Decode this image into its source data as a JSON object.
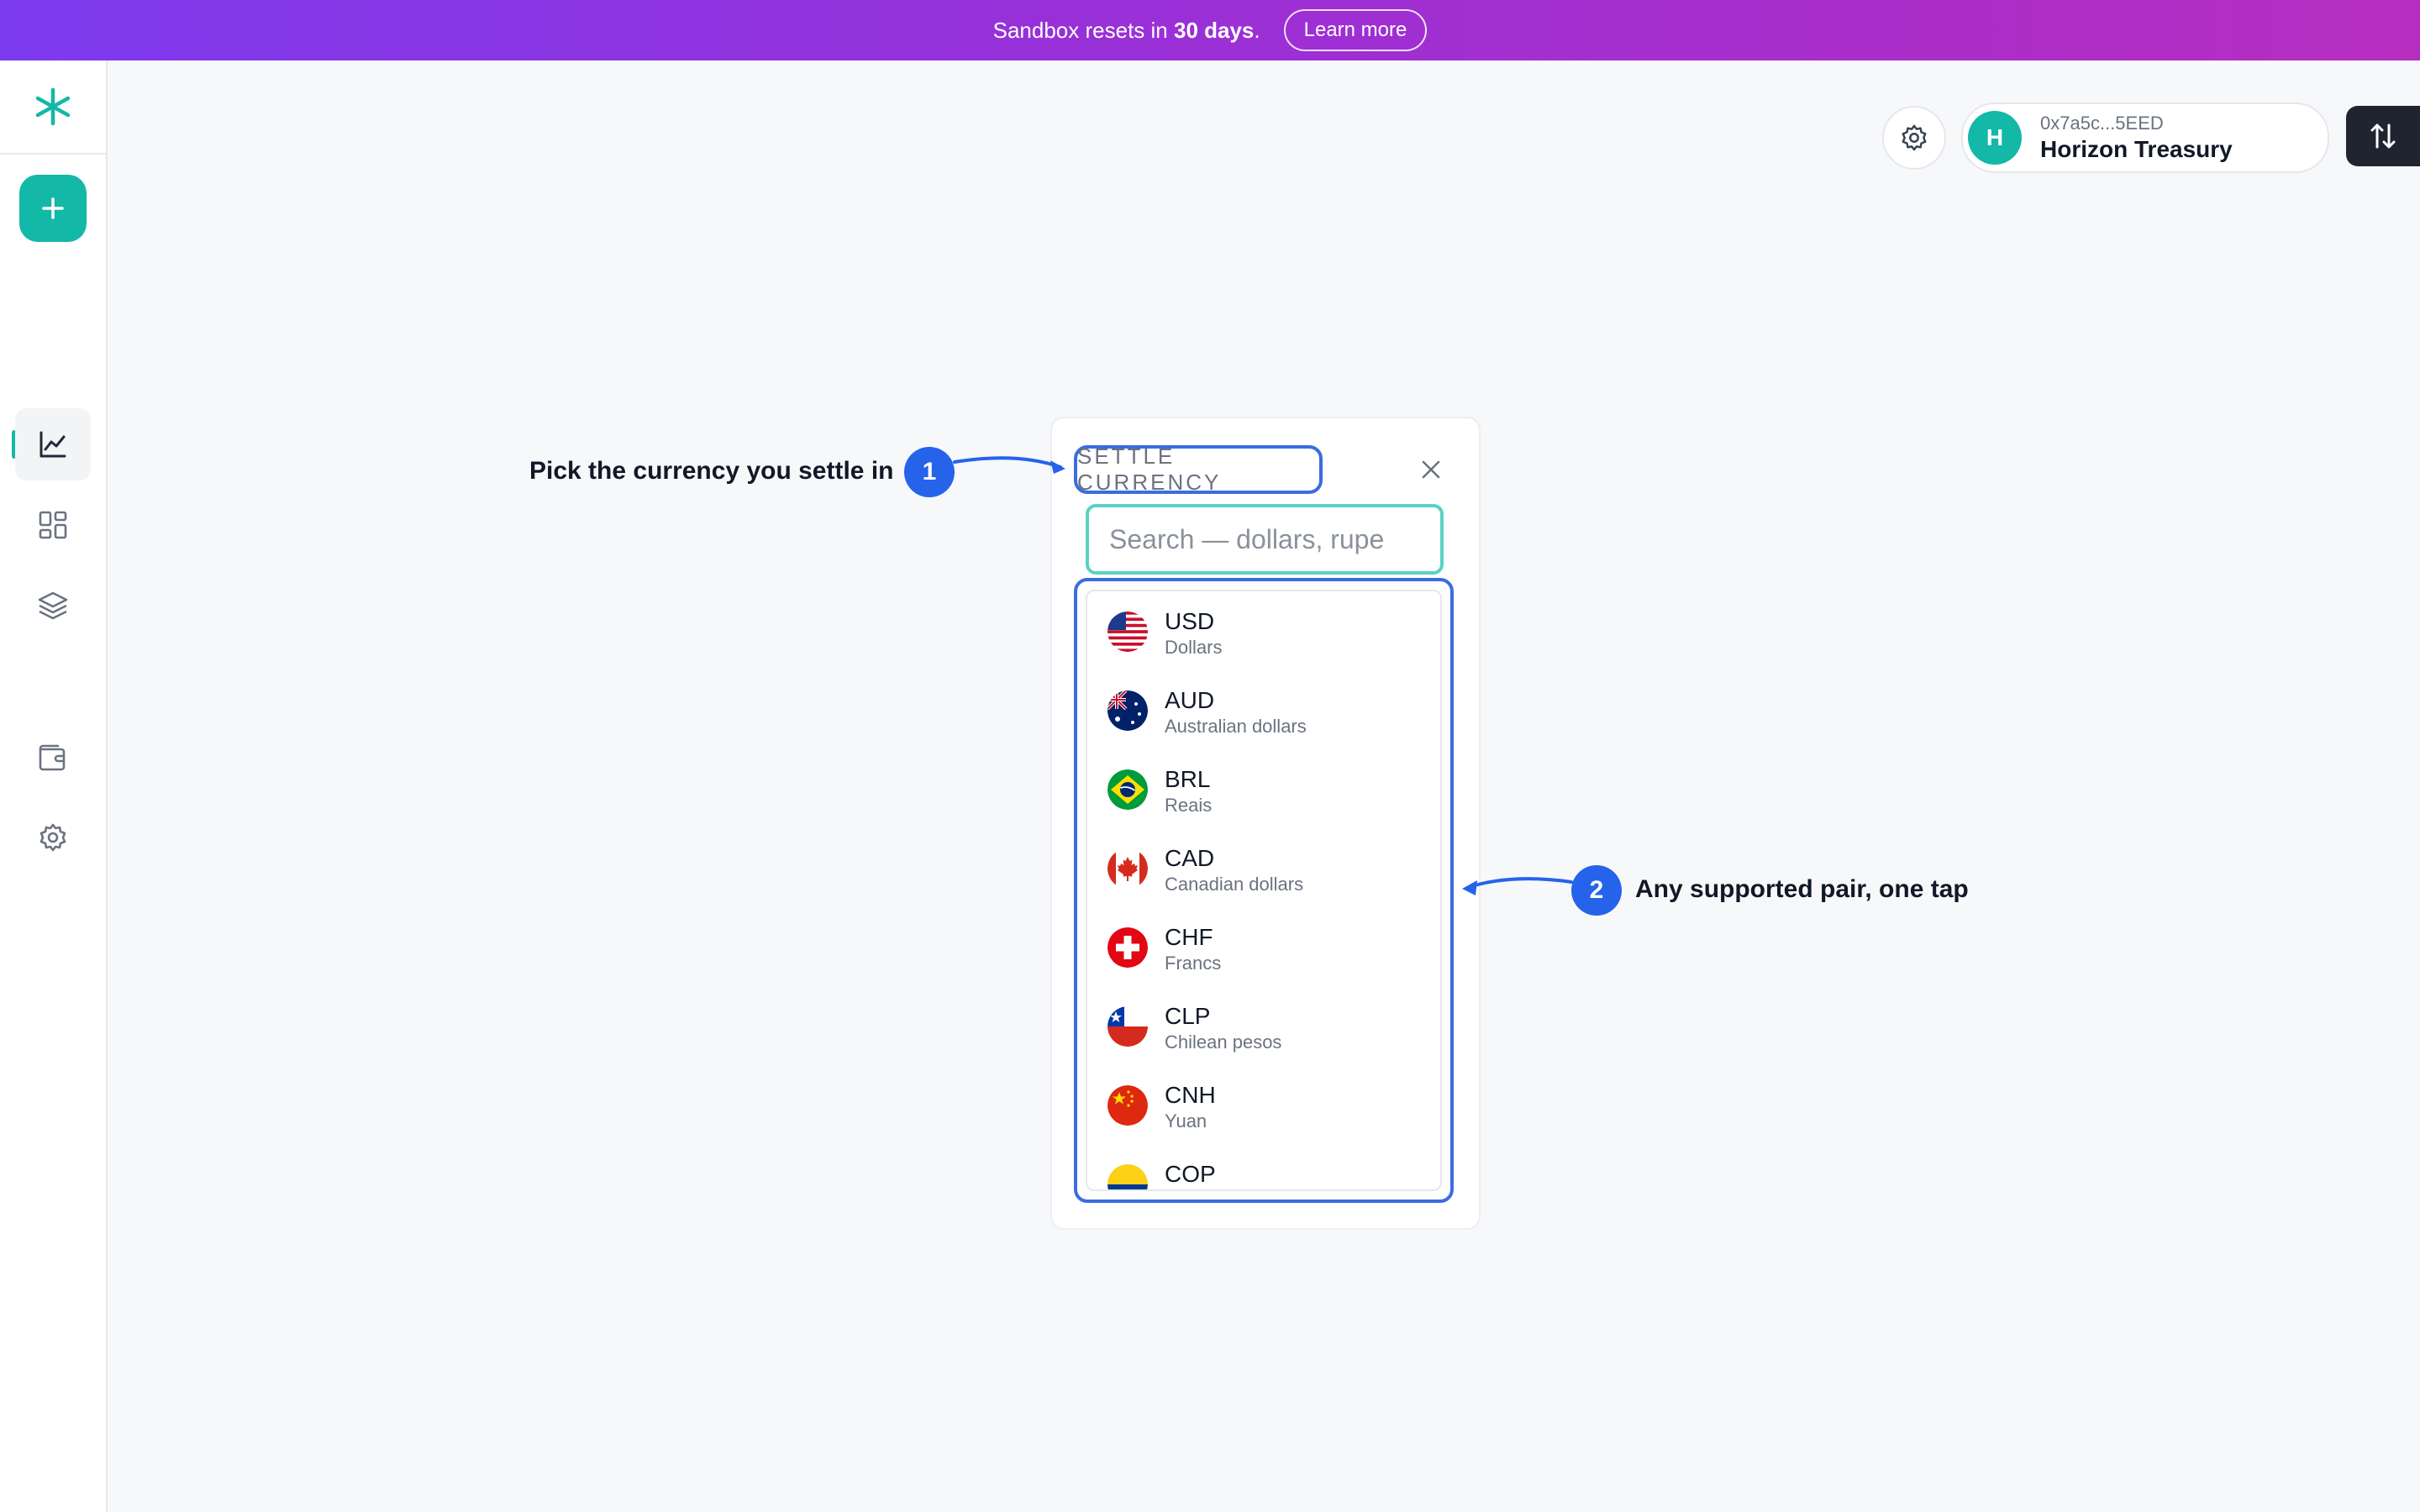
{
  "banner": {
    "message_prefix": "Sandbox resets in ",
    "message_bold": "30 days",
    "message_suffix": ".",
    "learn_more": "Learn more"
  },
  "sidebar": {
    "logo_icon": "asterisk-logo-icon",
    "add_icon": "plus-icon",
    "nav": [
      {
        "icon": "chart-line-icon",
        "active": true
      },
      {
        "icon": "grid-icon",
        "active": false
      },
      {
        "icon": "layers-icon",
        "active": false
      },
      {
        "icon": "wallet-icon",
        "active": false
      },
      {
        "icon": "gear-icon",
        "active": false
      }
    ]
  },
  "header": {
    "settings_icon": "gear-icon",
    "account": {
      "avatar_letter": "H",
      "address": "0x7a5c...5EED",
      "name": "Horizon Treasury"
    },
    "swap_icon": "swap-arrows-icon"
  },
  "modal": {
    "title": "SETTLE CURRENCY",
    "close_icon": "close-icon",
    "search": {
      "value": "",
      "placeholder": "Search — dollars, rupe"
    },
    "currencies": [
      {
        "code": "USD",
        "name": "Dollars",
        "flag": "us-flag-icon"
      },
      {
        "code": "AUD",
        "name": "Australian dollars",
        "flag": "au-flag-icon"
      },
      {
        "code": "BRL",
        "name": "Reais",
        "flag": "br-flag-icon"
      },
      {
        "code": "CAD",
        "name": "Canadian dollars",
        "flag": "ca-flag-icon"
      },
      {
        "code": "CHF",
        "name": "Francs",
        "flag": "ch-flag-icon"
      },
      {
        "code": "CLP",
        "name": "Chilean pesos",
        "flag": "cl-flag-icon"
      },
      {
        "code": "CNH",
        "name": "Yuan",
        "flag": "cn-flag-icon"
      },
      {
        "code": "COP",
        "name": "",
        "flag": "co-flag-icon"
      }
    ]
  },
  "callouts": [
    {
      "number": "1",
      "text": "Pick the currency you settle in"
    },
    {
      "number": "2",
      "text": "Any supported pair, one tap"
    }
  ],
  "colors": {
    "accent": "#14b8a6",
    "callout_blue": "#2563eb",
    "banner_start": "#7c3aed",
    "banner_end": "#b62ec0"
  }
}
